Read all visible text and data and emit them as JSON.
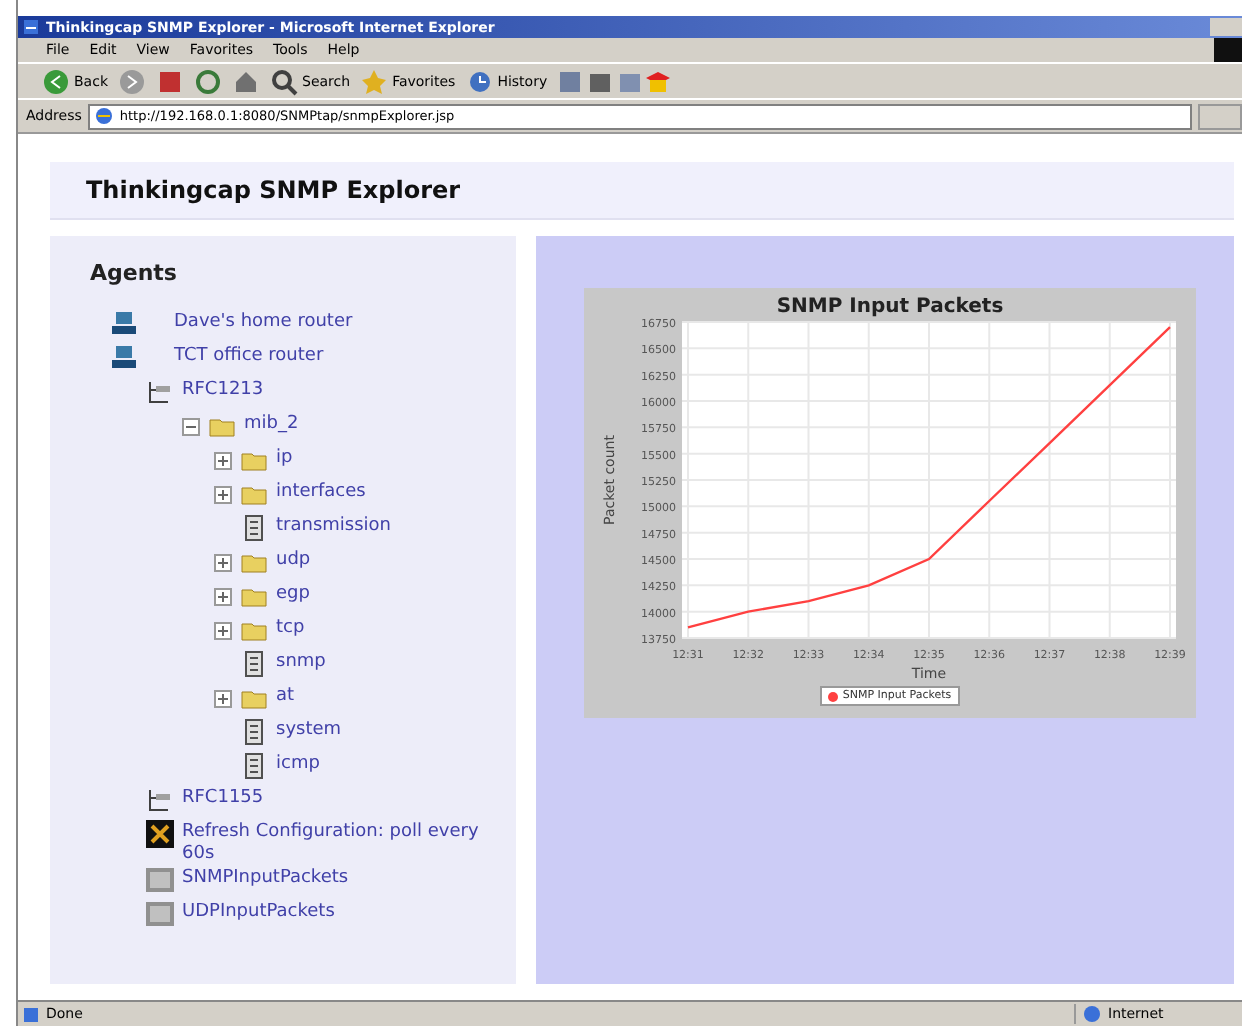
{
  "window": {
    "title": "Thinkingcap SNMP Explorer - Microsoft Internet Explorer"
  },
  "menu": [
    "File",
    "Edit",
    "View",
    "Favorites",
    "Tools",
    "Help"
  ],
  "toolbar": [
    {
      "kind": "back",
      "label": "Back"
    },
    {
      "kind": "forward"
    },
    {
      "kind": "stop"
    },
    {
      "kind": "refresh"
    },
    {
      "kind": "home"
    },
    {
      "kind": "search",
      "label": "Search"
    },
    {
      "kind": "favorites",
      "label": "Favorites"
    },
    {
      "kind": "history",
      "label": "History"
    }
  ],
  "address": {
    "label": "Address",
    "value": "http://192.168.0.1:8080/SNMPtap/snmpExplorer.jsp"
  },
  "page": {
    "title": "Thinkingcap SNMP Explorer",
    "agents_heading": "Agents",
    "tree": [
      {
        "kind": "router",
        "label": "Dave's home router"
      },
      {
        "kind": "router",
        "label": "TCT office router",
        "children": [
          {
            "kind": "mib",
            "label": "RFC1213",
            "children": [
              {
                "kind": "folder",
                "label": "mib_2",
                "expanded": true,
                "children": [
                  {
                    "kind": "folder",
                    "label": "ip",
                    "expanded": false
                  },
                  {
                    "kind": "folder",
                    "label": "interfaces",
                    "expanded": false
                  },
                  {
                    "kind": "leaf",
                    "label": "transmission"
                  },
                  {
                    "kind": "folder",
                    "label": "udp",
                    "expanded": false
                  },
                  {
                    "kind": "folder",
                    "label": "egp",
                    "expanded": false
                  },
                  {
                    "kind": "folder",
                    "label": "tcp",
                    "expanded": false
                  },
                  {
                    "kind": "leaf",
                    "label": "snmp"
                  },
                  {
                    "kind": "folder",
                    "label": "at",
                    "expanded": false
                  },
                  {
                    "kind": "leaf",
                    "label": "system"
                  },
                  {
                    "kind": "leaf",
                    "label": "icmp"
                  }
                ]
              }
            ]
          },
          {
            "kind": "mib",
            "label": "RFC1155"
          },
          {
            "kind": "action",
            "label": "Refresh Configuration: poll every 60s"
          },
          {
            "kind": "graph",
            "label": "SNMPInputPackets"
          },
          {
            "kind": "graph",
            "label": "UDPInputPackets"
          }
        ]
      }
    ],
    "chart_data": {
      "type": "line",
      "title": "SNMP Input Packets",
      "xlabel": "Time",
      "ylabel": "Packet count",
      "categories": [
        "12:31",
        "12:32",
        "12:33",
        "12:34",
        "12:35",
        "12:36",
        "12:37",
        "12:38",
        "12:39"
      ],
      "series": [
        {
          "name": "SNMP Input Packets",
          "color": "#ff4040",
          "values": [
            13850,
            14000,
            14100,
            14250,
            14500,
            15050,
            15600,
            16150,
            16700
          ]
        }
      ],
      "grid": true,
      "ylim": [
        13750,
        16750
      ],
      "yticks": [
        13750,
        14000,
        14250,
        14500,
        14750,
        15000,
        15250,
        15500,
        15750,
        16000,
        16250,
        16500,
        16750
      ]
    }
  },
  "status_bar": {
    "text": "Done",
    "zone": "Internet"
  }
}
